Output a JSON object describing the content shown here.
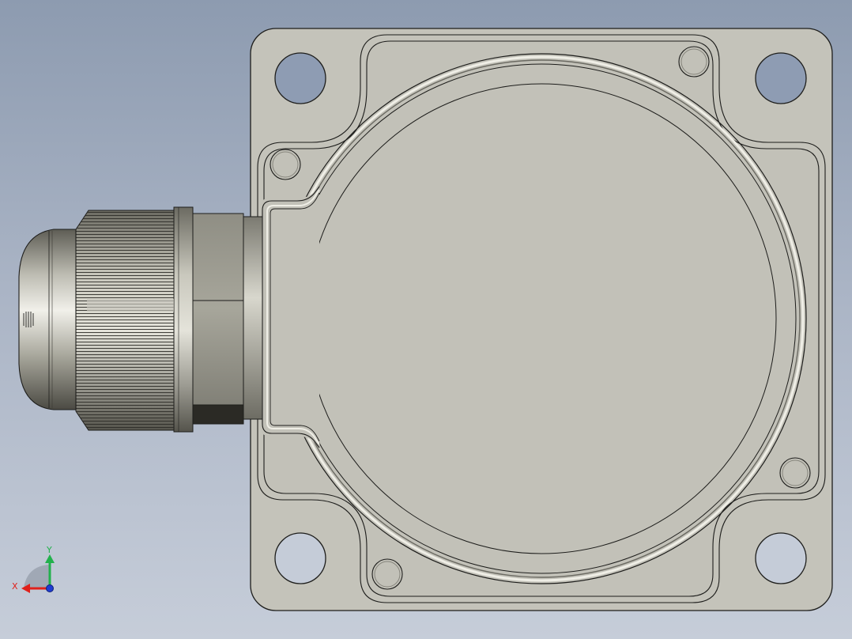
{
  "model": {
    "name": "",
    "colors": {
      "background_top": "#8d9bb0",
      "background_bottom": "#c6cdd9",
      "part_face": "#c2c1b8",
      "part_edge": "#1d1d1b",
      "connector_metal": "#9a9a8c",
      "connector_dark": "#2a2a25"
    }
  },
  "triad": {
    "x_label": "X",
    "y_label": "Y",
    "x_color": "#e0201b",
    "y_color": "#22b14c",
    "z_color": "#1f3cd1"
  }
}
